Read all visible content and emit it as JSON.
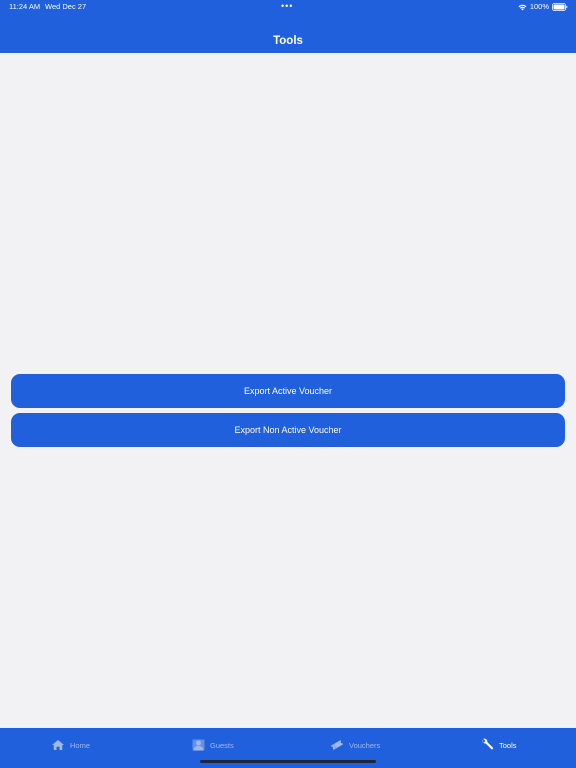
{
  "status_bar": {
    "time": "11:24 AM",
    "date": "Wed Dec 27",
    "dots": "•••",
    "battery": "100%",
    "wifi_icon": "wifi-icon",
    "battery_icon": "battery-icon"
  },
  "nav": {
    "title": "Tools"
  },
  "actions": {
    "export_active": "Export Active Voucher",
    "export_non_active": "Export Non Active Voucher"
  },
  "tab_bar": {
    "tabs": [
      {
        "label": "Home",
        "icon": "house-icon",
        "selected": false
      },
      {
        "label": "Guests",
        "icon": "person-icon",
        "selected": false
      },
      {
        "label": "Vouchers",
        "icon": "ticket-icon",
        "selected": false
      },
      {
        "label": "Tools",
        "icon": "wrench-icon",
        "selected": true
      }
    ]
  },
  "colors": {
    "accent": "#2160dc",
    "background": "#f2f2f4",
    "tab_inactive": "#9fb8ec",
    "text_on_accent": "#ffffff"
  }
}
